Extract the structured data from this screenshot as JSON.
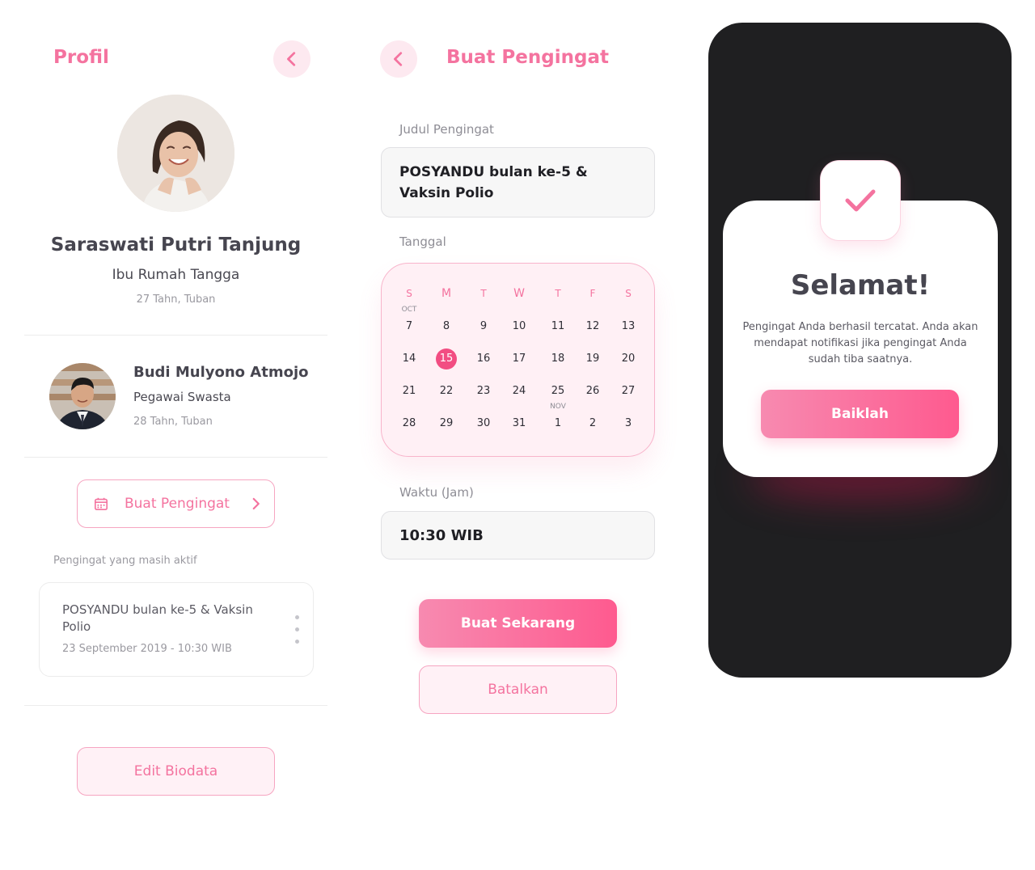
{
  "profile": {
    "title": "Profil",
    "name": "Saraswati Putri Tanjung",
    "occupation": "Ibu Rumah Tangga",
    "age_location": "27 Tahn, Tuban",
    "spouse": {
      "name": "Budi Mulyono Atmojo",
      "occupation": "Pegawai Swasta",
      "age_location": "28 Tahn, Tuban"
    },
    "create_reminder_label": "Buat Pengingat",
    "active_label": "Pengingat yang masih aktif",
    "active_reminder": {
      "title": "POSYANDU bulan ke-5 & Vaksin Polio",
      "datetime": "23 September 2019 - 10:30 WIB"
    },
    "edit_label": "Edit Biodata"
  },
  "create": {
    "title": "Buat Pengingat",
    "title_label": "Judul Pengingat",
    "title_value": "POSYANDU bulan ke-5 & Vaksin Polio",
    "date_label": "Tanggal",
    "calendar": {
      "weekdays": [
        "S",
        "M",
        "T",
        "W",
        "T",
        "F",
        "S"
      ],
      "month_labels": [
        "OCT",
        "NOV"
      ],
      "weeks": [
        [
          "7",
          "8",
          "9",
          "10",
          "11",
          "12",
          "13"
        ],
        [
          "14",
          "15",
          "16",
          "17",
          "18",
          "19",
          "20"
        ],
        [
          "21",
          "22",
          "23",
          "24",
          "25",
          "26",
          "27"
        ],
        [
          "28",
          "29",
          "30",
          "31",
          "1",
          "2",
          "3"
        ]
      ],
      "selected": "15"
    },
    "time_label": "Waktu (Jam)",
    "time_value": "10:30 WIB",
    "submit_label": "Buat Sekarang",
    "cancel_label": "Batalkan"
  },
  "success": {
    "title": "Selamat!",
    "message": "Pengingat Anda berhasil tercatat. Anda akan mendapat notifikasi jika pengingat Anda sudah tiba saatnya.",
    "ok_label": "Baiklah"
  },
  "colors": {
    "accent": "#f4739f",
    "accent_strong": "#fe5a8f",
    "soft_pink": "#fff0f5",
    "dark_bg": "#1f1f21",
    "text_dark": "#46454f"
  },
  "icons": {
    "back": "chevron-left-icon",
    "calendar": "calendar-icon",
    "forward": "chevron-right-icon",
    "more": "kebab-icon",
    "success": "checkmark-icon"
  }
}
